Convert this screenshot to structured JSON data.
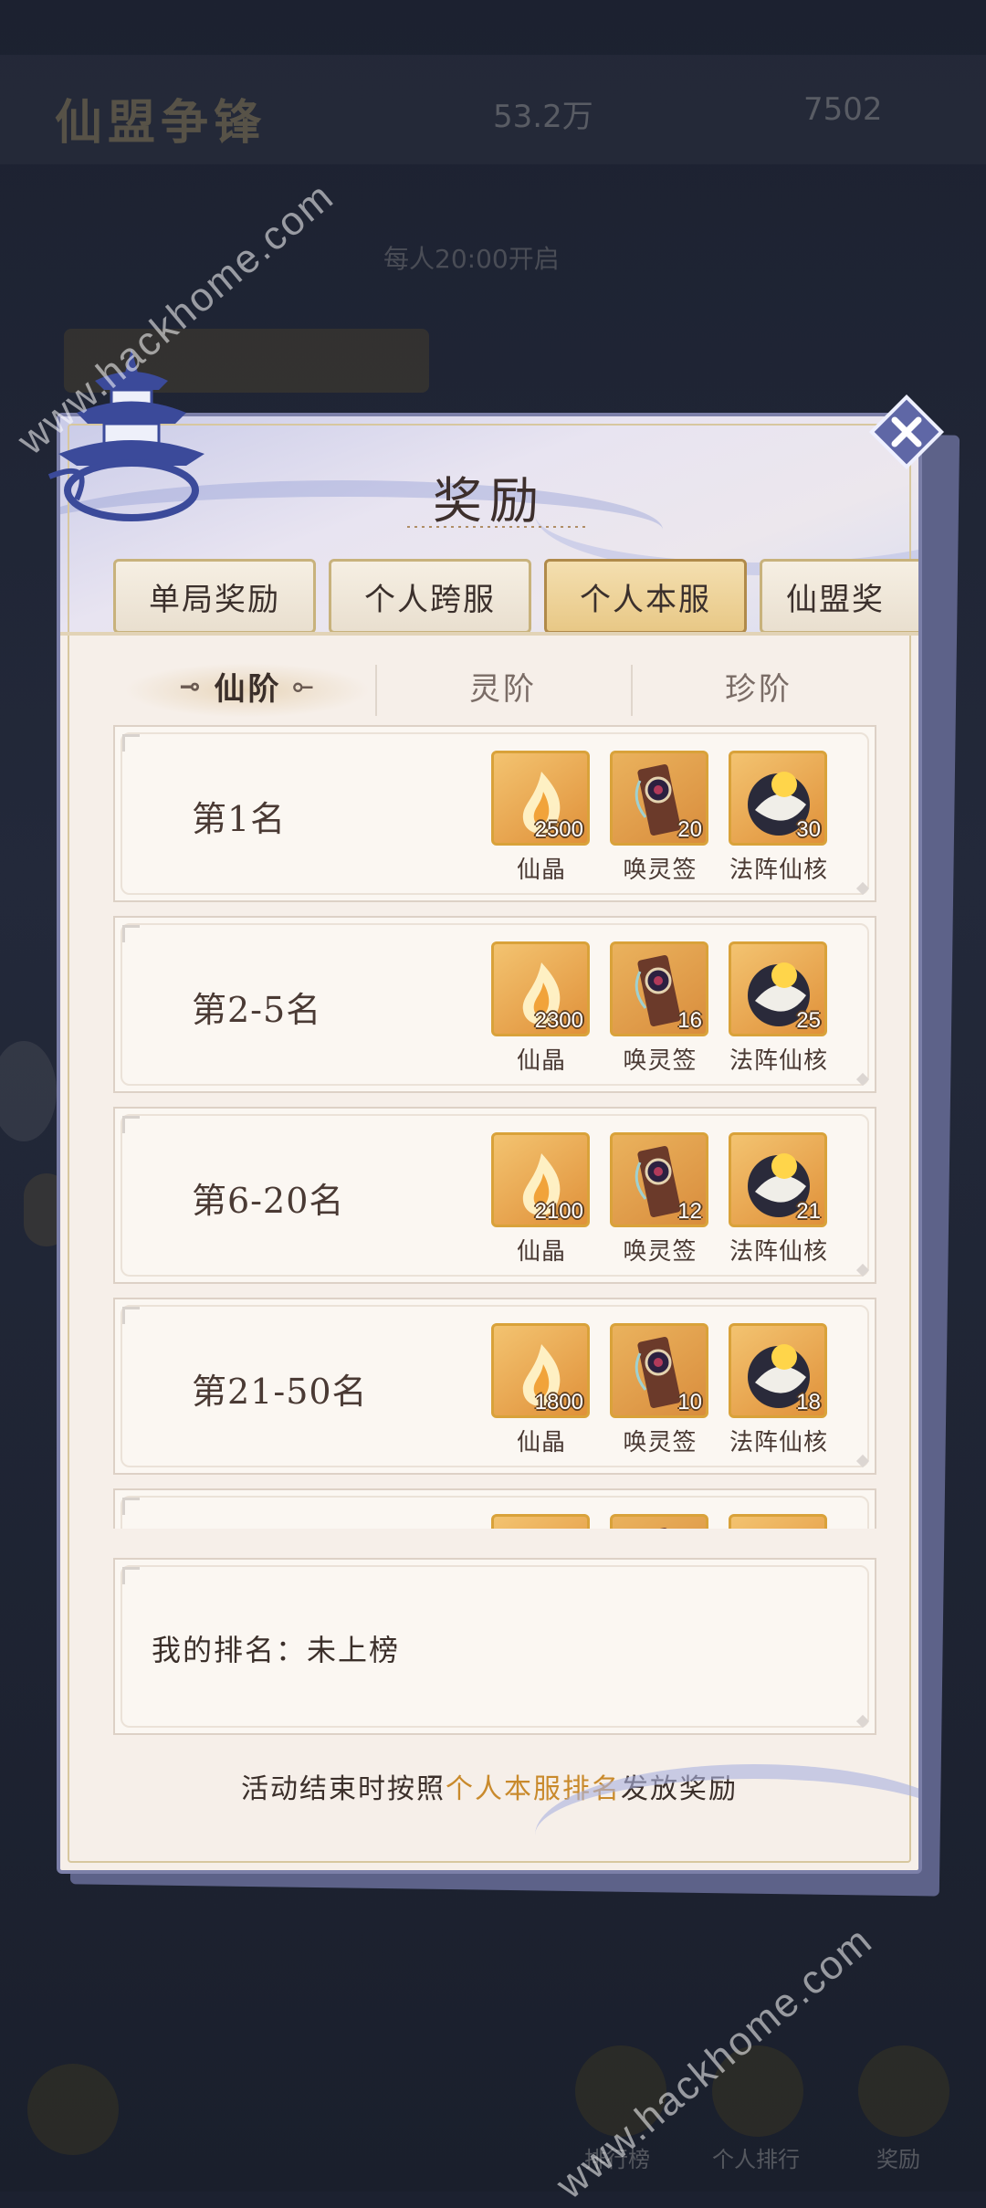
{
  "background": {
    "title": "仙盟争锋",
    "currency_1": "53.2万",
    "currency_2": "7502",
    "subtitle": "每人20:00开启",
    "nav": [
      "排行榜",
      "个人排行",
      "奖励"
    ]
  },
  "watermarks": [
    "www.hackhome.com",
    "www.hackhome.com"
  ],
  "dialog": {
    "title": "奖励",
    "tabs": [
      {
        "label": "单局奖励",
        "active": false
      },
      {
        "label": "个人跨服",
        "active": false
      },
      {
        "label": "个人本服",
        "active": true
      },
      {
        "label": "仙盟奖",
        "active": false
      }
    ],
    "subtabs": [
      {
        "label": "仙阶",
        "active": true
      },
      {
        "label": "灵阶",
        "active": false
      },
      {
        "label": "珍阶",
        "active": false
      }
    ],
    "reward_names": [
      "仙晶",
      "唤灵签",
      "法阵仙核"
    ],
    "ranks": [
      {
        "label": "第1名",
        "counts": [
          "2500",
          "20",
          "30"
        ]
      },
      {
        "label": "第2-5名",
        "counts": [
          "2300",
          "16",
          "25"
        ]
      },
      {
        "label": "第6-20名",
        "counts": [
          "2100",
          "12",
          "21"
        ]
      },
      {
        "label": "第21-50名",
        "counts": [
          "1800",
          "10",
          "18"
        ]
      },
      {
        "label": "",
        "counts": [
          "",
          "",
          ""
        ]
      }
    ],
    "my_rank_label": "我的排名：",
    "my_rank_value": "未上榜",
    "footer_pre": "活动结束时按照",
    "footer_highlight": "个人本服排名",
    "footer_post": "发放奖励",
    "colors": {
      "accent": "#c98a2c",
      "frame": "#7b7fa8",
      "active_tab": "#e8c886"
    }
  }
}
